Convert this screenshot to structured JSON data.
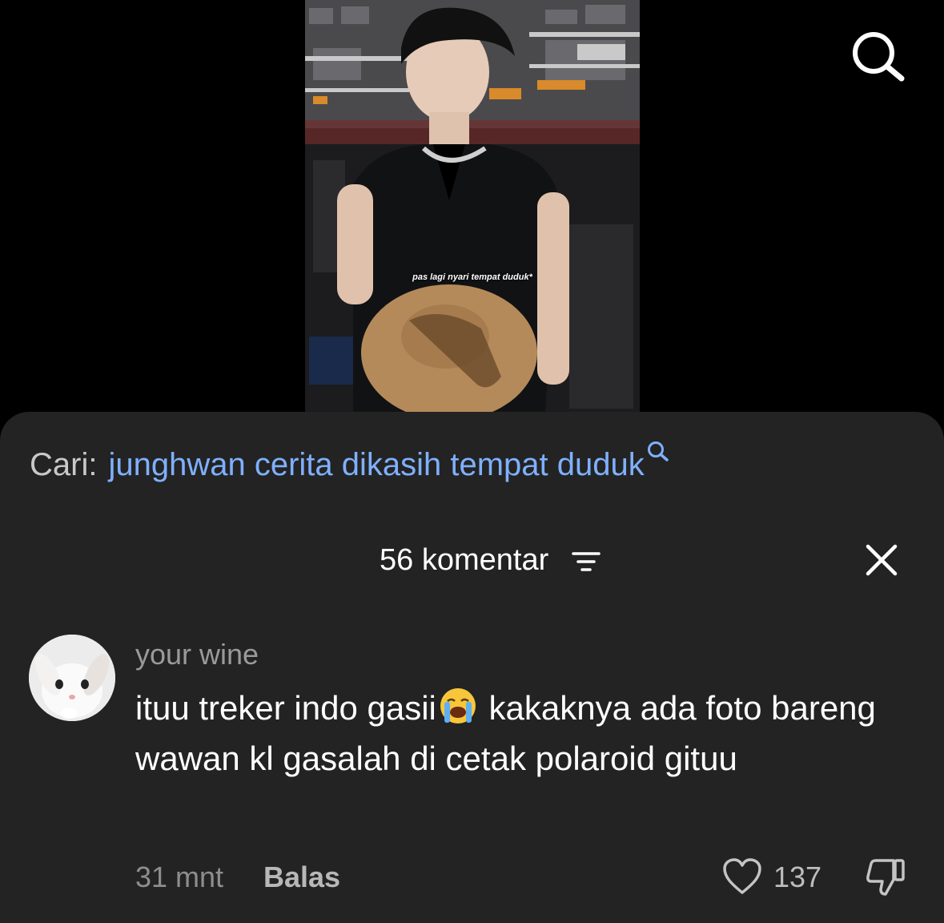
{
  "video": {
    "caption": "pas lagi nyari tempat duduk*"
  },
  "top_search_icon": "search-icon",
  "search_suggestion": {
    "prefix": "Cari:",
    "query": "junghwan cerita dikasih tempat duduk",
    "icon": "search-icon",
    "query_color": "#7fb0ff"
  },
  "comments_header": {
    "count_label": "56 komentar",
    "filter_icon": "filter-icon",
    "close_icon": "close-icon"
  },
  "comment": {
    "username": "your wine",
    "text_before_emoji": "ituu treker indo gasii",
    "emoji": "loudly-crying-face",
    "text_after_emoji": " kakaknya ada foto bareng wawan kl gasalah di cetak polaroid gituu",
    "timestamp": "31 mnt",
    "reply_label": "Balas",
    "like_count": "137",
    "avatar": "bunny-avatar"
  },
  "colors": {
    "background": "#000000",
    "sheet": "#232323",
    "link": "#7fb0ff"
  }
}
